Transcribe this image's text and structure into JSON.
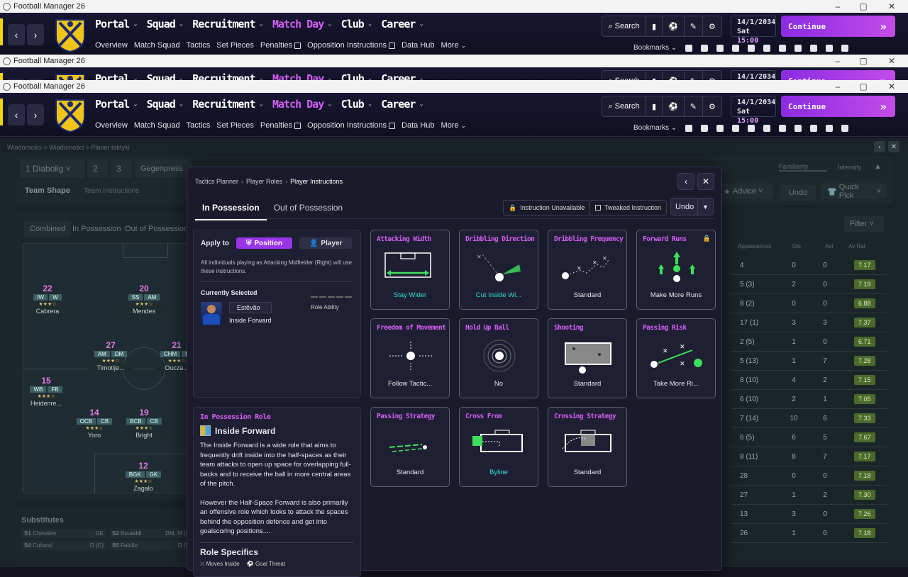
{
  "window": {
    "title": "Football Manager 26"
  },
  "nav": {
    "items": [
      "Portal",
      "Squad",
      "Recruitment",
      "Match Day",
      "Club",
      "Career"
    ],
    "active": "Match Day",
    "subitems": [
      "Overview",
      "Match Squad",
      "Tactics",
      "Set Pieces",
      "Penalties",
      "Opposition Instructions",
      "Data Hub",
      "More"
    ],
    "search_label": "Search",
    "date": "14/1/2034",
    "day_time_day": "Sat",
    "day_time_time": "15:00",
    "continue_label": "Continue",
    "bookmarks_label": "Bookmarks"
  },
  "background": {
    "breadcrumb": "Wiadomości > Wiadomości > Planer taktyki",
    "tactic_slots": [
      "1 Diabolig",
      "2",
      "3"
    ],
    "mentality": "Gegenpress",
    "familiarity_label": "Familiarity",
    "intensity_label": "Intensity",
    "team_tabs": [
      "Team Shape",
      "Team Instructions"
    ],
    "advice_label": "Advice",
    "undo_label": "Undo",
    "quick_pick_label": "Quick Pick",
    "filter_label": "Filter",
    "shape_tabs": [
      "Combined",
      "In Possession",
      "Out of Possession"
    ],
    "stats_headers": [
      "Appearances",
      "Gls",
      "Ast",
      "Av Rat"
    ],
    "stats_rows": [
      [
        "4",
        "0",
        "0",
        "7.17"
      ],
      [
        "5 (3)",
        "2",
        "0",
        "7.19"
      ],
      [
        "8 (2)",
        "0",
        "0",
        "6.88"
      ],
      [
        "17 (1)",
        "3",
        "3",
        "7.37"
      ],
      [
        "2 (5)",
        "1",
        "0",
        "6.71"
      ],
      [
        "5 (13)",
        "1",
        "7",
        "7.28"
      ],
      [
        "8 (10)",
        "4",
        "2",
        "7.15"
      ],
      [
        "6 (10)",
        "2",
        "1",
        "7.05"
      ],
      [
        "7 (14)",
        "10",
        "6",
        "7.33"
      ],
      [
        "6 (5)",
        "6",
        "5",
        "7.67"
      ],
      [
        "8 (11)",
        "8",
        "7",
        "7.17"
      ],
      [
        "28",
        "0",
        "0",
        "7.18"
      ],
      [
        "27",
        "1",
        "2",
        "7.30"
      ],
      [
        "13",
        "3",
        "0",
        "7.26"
      ],
      [
        "26",
        "1",
        "0",
        "7.18"
      ]
    ],
    "players": [
      {
        "num": "22",
        "pos": [
          "IW",
          "W"
        ],
        "name": "Cabrera"
      },
      {
        "num": "20",
        "pos": [
          "SS",
          "AM"
        ],
        "name": "Mendes"
      },
      {
        "num": "27",
        "pos": [
          "AM",
          "DM"
        ],
        "name": "Timotije..."
      },
      {
        "num": "21",
        "pos": [
          "CHM",
          "D"
        ],
        "name": "Oucza..."
      },
      {
        "num": "15",
        "pos": [
          "WB",
          "FB"
        ],
        "name": "Heidenre..."
      },
      {
        "num": "14",
        "pos": [
          "OCB",
          "CB"
        ],
        "name": "Yoro"
      },
      {
        "num": "19",
        "pos": [
          "BCB",
          "CB"
        ],
        "name": "Bright"
      },
      {
        "num": "12",
        "pos": [
          "BGK",
          "GK"
        ],
        "name": "Zagalo"
      }
    ],
    "substitutes_label": "Substitutes",
    "substitutes": [
      {
        "slot": "S1",
        "name": "Chevalier",
        "pos": "GK"
      },
      {
        "slot": "S2",
        "name": "Bouaddi",
        "pos": "DM, M (C)"
      },
      {
        "slot": "S4",
        "name": "Cubarsí",
        "pos": "D (C)"
      },
      {
        "slot": "S5",
        "name": "Falcão",
        "pos": "D (R)"
      }
    ]
  },
  "modal": {
    "breadcrumb": [
      "Tactics Planner",
      "Player Roles",
      "Player Instructions"
    ],
    "tabs": [
      "In Possession",
      "Out of Possession"
    ],
    "legend_unavailable": "Instruction Unavailable",
    "legend_tweaked": "Tweaked Instruction",
    "undo_label": "Undo",
    "apply_to_label": "Apply to",
    "apply_position": "Position",
    "apply_player": "Player",
    "apply_description": "All individuals playing as Attacking Midfielder (Right) will use these instructions.",
    "currently_selected_label": "Currently Selected",
    "player_name": "Estêvão",
    "player_role": "Inside Forward",
    "role_ability_label": "Role Ability",
    "role_section_label": "In Possession Role",
    "role_title": "Inside Forward",
    "role_desc_1": "The Inside Forward is a wide role that aims to frequently drift inside into the half-spaces as their team attacks to open up space for overlapping full-backs and to receive the ball in more central areas of the pitch.",
    "role_desc_2": "However the Half-Space Forward is also primarily an offensive role which looks to attack the spaces behind the opposition defence and get into goalscoring positions....",
    "role_specifics_label": "Role Specifics",
    "role_specifics": [
      "Moves Inside",
      "Goal Threat"
    ],
    "cards": [
      {
        "title": "Attacking Width",
        "value": "Stay Wider",
        "highlight": true,
        "icon": "width-icon",
        "locked": false
      },
      {
        "title": "Dribbling Direction",
        "value": "Cut Inside Wi...",
        "highlight": true,
        "icon": "dribble-dir-icon",
        "locked": false
      },
      {
        "title": "Dribbling Frequency",
        "value": "Standard",
        "highlight": false,
        "icon": "dribble-freq-icon",
        "locked": false
      },
      {
        "title": "Forward Runs",
        "value": "Make More Runs",
        "highlight": false,
        "icon": "forward-runs-icon",
        "locked": true
      },
      {
        "title": "Freedom of Movement",
        "value": "Follow Tactic...",
        "highlight": false,
        "icon": "freedom-icon",
        "locked": false
      },
      {
        "title": "Hold Up Ball",
        "value": "No",
        "highlight": false,
        "icon": "hold-up-icon",
        "locked": false
      },
      {
        "title": "Shooting",
        "value": "Standard",
        "highlight": false,
        "icon": "shooting-icon",
        "locked": false
      },
      {
        "title": "Passing Risk",
        "value": "Take More Ri...",
        "highlight": false,
        "icon": "passing-risk-icon",
        "locked": false
      },
      {
        "title": "Passing Strategy",
        "value": "Standard",
        "highlight": false,
        "icon": "passing-strategy-icon",
        "locked": false
      },
      {
        "title": "Cross From",
        "value": "Byline",
        "highlight": true,
        "icon": "cross-from-icon",
        "locked": false
      },
      {
        "title": "Crossing Strategy",
        "value": "Standard",
        "highlight": false,
        "icon": "crossing-strategy-icon",
        "locked": false
      }
    ]
  },
  "colors": {
    "accent": "#d35df5",
    "highlight": "#2ee0d0",
    "continue_start": "#8a2be2",
    "continue_end": "#c44ce8"
  }
}
